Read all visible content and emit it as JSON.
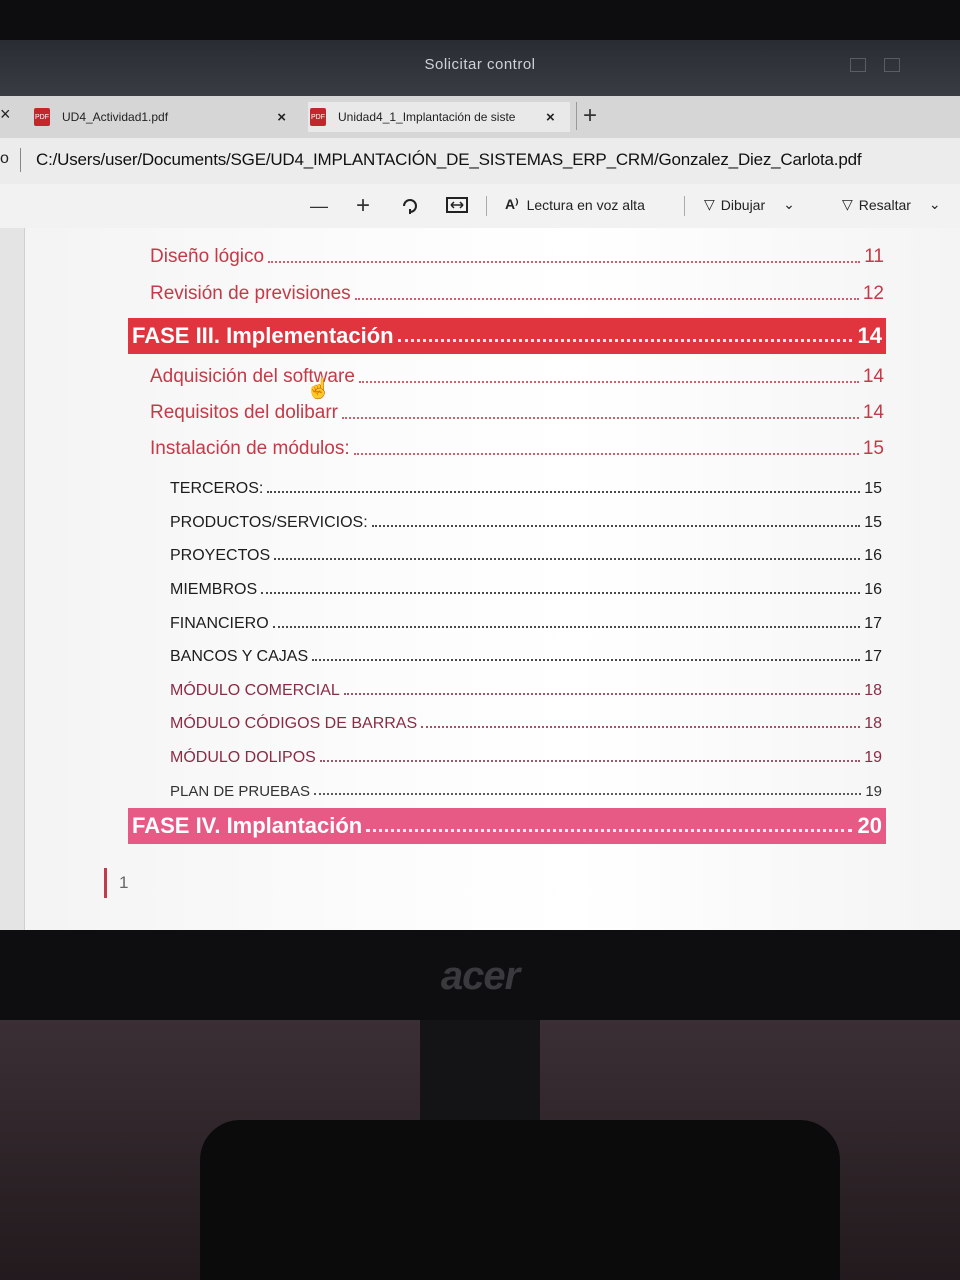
{
  "remote": {
    "title": "Solicitar control"
  },
  "tabs": {
    "left_close": "×",
    "tab1": {
      "label": "UD4_Actividad1.pdf",
      "close": "×"
    },
    "tab2": {
      "label": "Unidad4_1_Implantación de siste",
      "close": "×"
    },
    "new_tab": "+"
  },
  "address": {
    "left_glyph": "o",
    "path": "C:/Users/user/Documents/SGE/UD4_IMPLANTACIÓN_DE_SISTEMAS_ERP_CRM/Gonzalez_Diez_Carlota.pdf"
  },
  "toolbar": {
    "zoom_out": "—",
    "zoom_in": "+",
    "read_aloud": "Lectura en voz alta",
    "read_aloud_icon": "A⁾",
    "draw": "Dibujar",
    "highlight": "Resaltar"
  },
  "toc": {
    "l1": [
      {
        "title": "Diseño lógico",
        "page": "11"
      },
      {
        "title": "Revisión de previsiones",
        "page": "12"
      }
    ],
    "fase3": {
      "title": "FASE III. Implementación",
      "page": "14"
    },
    "l2": [
      {
        "title": "Adquisición del software",
        "page": "14"
      },
      {
        "title": "Requisitos del dolibarr",
        "page": "14"
      },
      {
        "title": "Instalación de módulos:",
        "page": "15"
      }
    ],
    "modules": [
      {
        "title": "TERCEROS:",
        "page": "15"
      },
      {
        "title": "PRODUCTOS/SERVICIOS:",
        "page": "15"
      },
      {
        "title": "PROYECTOS",
        "page": "16"
      },
      {
        "title": "MIEMBROS",
        "page": "16"
      },
      {
        "title": "FINANCIERO",
        "page": "17"
      },
      {
        "title": "BANCOS Y CAJAS",
        "page": "17"
      },
      {
        "title": "MÓDULO COMERCIAL",
        "page": "18"
      },
      {
        "title": "MÓDULO CÓDIGOS DE BARRAS",
        "page": "18"
      },
      {
        "title": "MÓDULO DOLIPOS",
        "page": "19"
      },
      {
        "title": "PLAN DE PRUEBAS",
        "page": "19"
      }
    ],
    "fase4": {
      "title": "FASE IV. Implantación",
      "page": "20"
    },
    "page_number": "1"
  },
  "monitor": {
    "brand": "acer"
  },
  "colors": {
    "fase3_bg": "#e0343e",
    "fase4_bg": "#e85a86",
    "accent": "#c43a48"
  }
}
